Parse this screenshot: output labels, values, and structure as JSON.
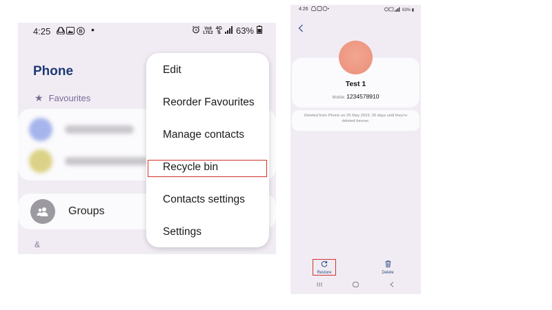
{
  "left_screen": {
    "status_bar": {
      "time": "4:25",
      "network_top": "Vo8",
      "network_bottom": "LTE2",
      "network_type": "4G",
      "battery": "63%"
    },
    "title": "Phone",
    "favourites_label": "Favourites",
    "groups_label": "Groups",
    "index_char": "&",
    "menu": {
      "items": [
        "Edit",
        "Reorder Favourites",
        "Manage contacts",
        "Recycle bin",
        "Contacts settings",
        "Settings"
      ],
      "highlighted_index": 3
    },
    "colors": {
      "title": "#1f3a75",
      "avatar_1": "#a6b6ec",
      "avatar_2": "#dcd287",
      "highlight": "#d0312d"
    }
  },
  "right_screen": {
    "status_bar": {
      "time": "4:26",
      "battery": "63%"
    },
    "contact": {
      "name": "Test 1",
      "mobile_label": "Mobile",
      "mobile_number": "1234578910"
    },
    "deleted_notice": "Deleted from Phone on 25 May 2023. 30 days until they're deleted forever.",
    "actions": {
      "restore_label": "Restore",
      "delete_label": "Delete"
    },
    "colors": {
      "avatar": "#ee9a84",
      "action": "#2c4a80"
    }
  }
}
